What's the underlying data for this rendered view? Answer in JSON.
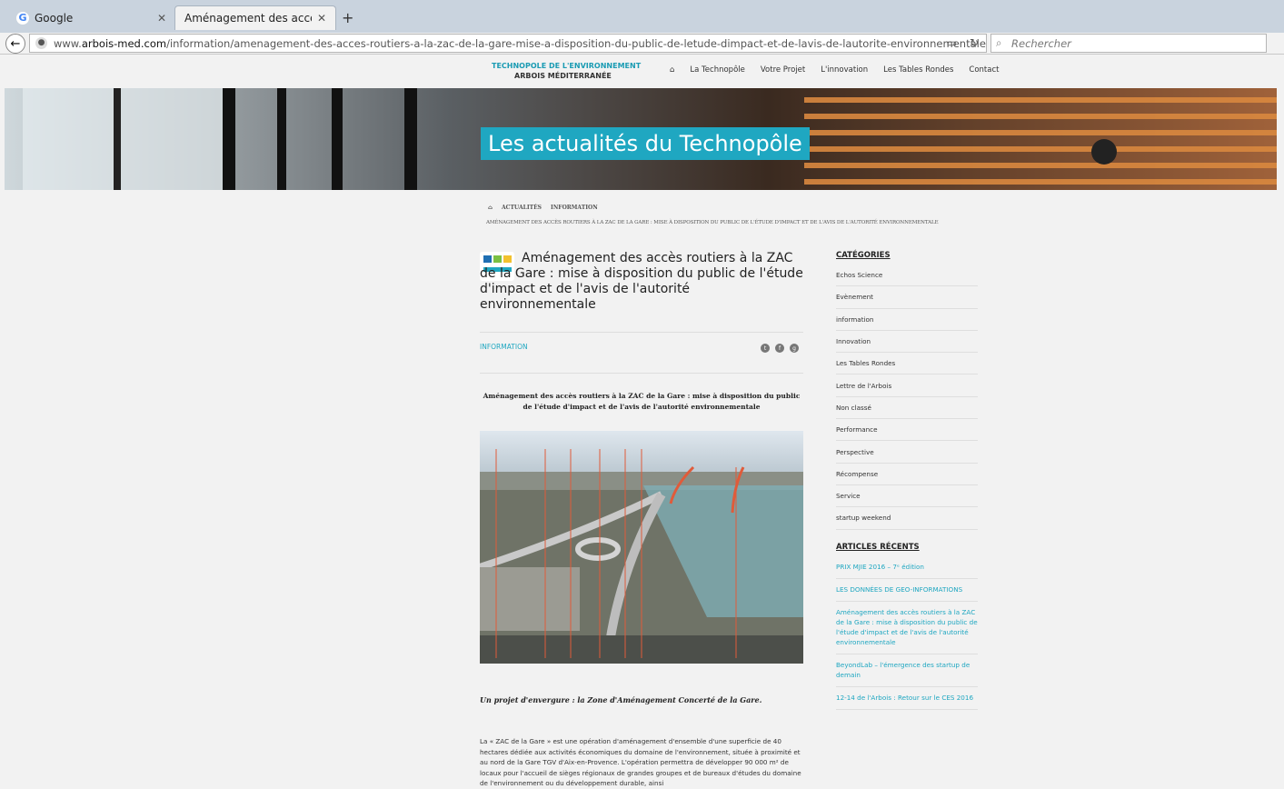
{
  "browser": {
    "tabs": [
      {
        "label": "Google",
        "favicon": "google-g-icon"
      },
      {
        "label": "Aménagement des accès routi...",
        "favicon": ""
      }
    ],
    "new_tab_symbol": "+",
    "url_prefix": "www.",
    "url_domain": "arbois-med.com",
    "url_path": "/information/amenagement-des-acces-routiers-a-la-zac-de-la-gare-mise-a-disposition-du-public-de-letude-dimpact-et-de-lavis-de-lautorite-environnementale/",
    "search_placeholder": "Rechercher"
  },
  "site": {
    "brand_line1": "TECHNOPOLE DE L'ENVIRONNEMENT",
    "brand_line2": "ARBOIS MÉDITERRANÉE",
    "nav": [
      "La Technopôle",
      "Votre Projet",
      "L'innovation",
      "Les Tables Rondes",
      "Contact"
    ],
    "hero_title": "Les actualités du Technopôle",
    "accent_color": "#1fa7c1"
  },
  "breadcrumb": {
    "items": [
      "ACTUALITÉS",
      "INFORMATION"
    ],
    "current": "AMÉNAGEMENT DES ACCÈS ROUTIERS À LA ZAC DE LA GARE : MISE À DISPOSITION DU PUBLIC DE L'ÉTUDE D'IMPACT ET DE L'AVIS DE L'AUTORITÉ ENVIRONNEMENTALE"
  },
  "article": {
    "title": "Aménagement des accès routiers à la ZAC de la Gare : mise à disposition du public de l'étude d'impact et de l'avis de l'autorité environnementale",
    "category": "INFORMATION",
    "subtitle": "Aménagement des accès routiers à la ZAC de la Gare : mise à disposition du public de l'étude d'impact et de l'avis de l'autorité environnementale",
    "lead": "Un projet d'envergure : la Zone d'Aménagement Concerté de la Gare.",
    "body": "La « ZAC de la Gare » est une opération d'aménagement d'ensemble d'une superficie de 40 hectares dédiée aux activités économiques du domaine de l'environnement, située à proximité et au nord de la Gare TGV d'Aix-en-Provence. L'opération permettra de développer 90 000 m² de locaux pour l'accueil de sièges régionaux de grandes groupes et de bureaux d'études du domaine de l'environnement ou du développement durable, ainsi"
  },
  "sidebar": {
    "categories_title": "CATÉGORIES",
    "categories": [
      "Echos Science",
      "Evènement",
      "information",
      "Innovation",
      "Les Tables Rondes",
      "Lettre de l'Arbois",
      "Non classé",
      "Performance",
      "Perspective",
      "Récompense",
      "Service",
      "startup weekend"
    ],
    "recent_title": "ARTICLES RÉCENTS",
    "recent": [
      "PRIX MJIE 2016 – 7ᵉ édition",
      "LES DONNÉES DE GEO-INFORMATIONS",
      "Aménagement des accès routiers à la ZAC de la Gare : mise à disposition du public de l'étude d'impact et de l'avis de l'autorité environnementale",
      "BeyondLab – l'émergence des startup de demain",
      "12-14 de l'Arbois : Retour sur le CES 2016"
    ]
  }
}
